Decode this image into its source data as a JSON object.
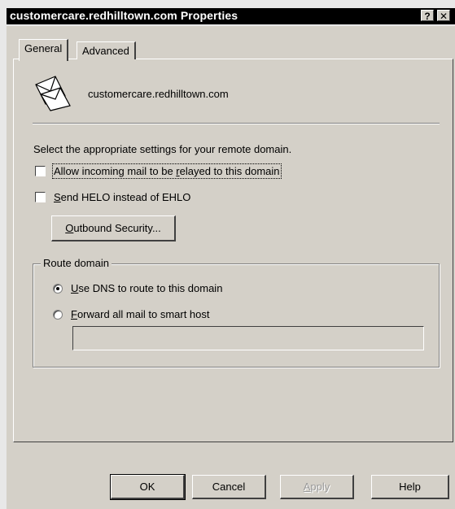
{
  "window": {
    "title": "customercare.redhilltown.com Properties",
    "help_button": "?",
    "close_button": "✕"
  },
  "tabs": [
    {
      "label": "General",
      "active": true
    },
    {
      "label": "Advanced",
      "active": false
    }
  ],
  "general": {
    "domain_name": "customercare.redhilltown.com",
    "instruction": "Select the appropriate settings for your remote domain.",
    "checkboxes": [
      {
        "label_pre": "Allow incoming mail to be ",
        "label_key": "r",
        "label_post": "elayed to this domain",
        "checked": false
      },
      {
        "label_pre": "",
        "label_key": "S",
        "label_post": "end HELO instead of EHLO",
        "checked": false
      }
    ],
    "outbound_button": {
      "label_pre": "",
      "label_key": "O",
      "label_post": "utbound Security..."
    },
    "route_group": {
      "label": "Route domain",
      "options": [
        {
          "label_pre": "",
          "label_key": "U",
          "label_post": "se DNS to route to this domain",
          "selected": true
        },
        {
          "label_pre": "",
          "label_key": "F",
          "label_post": "orward all mail to smart host",
          "selected": false
        }
      ],
      "smart_host_value": ""
    }
  },
  "footer": {
    "ok": "OK",
    "cancel": "Cancel",
    "apply_key": "A",
    "apply_post": "pply",
    "help": "Help"
  }
}
